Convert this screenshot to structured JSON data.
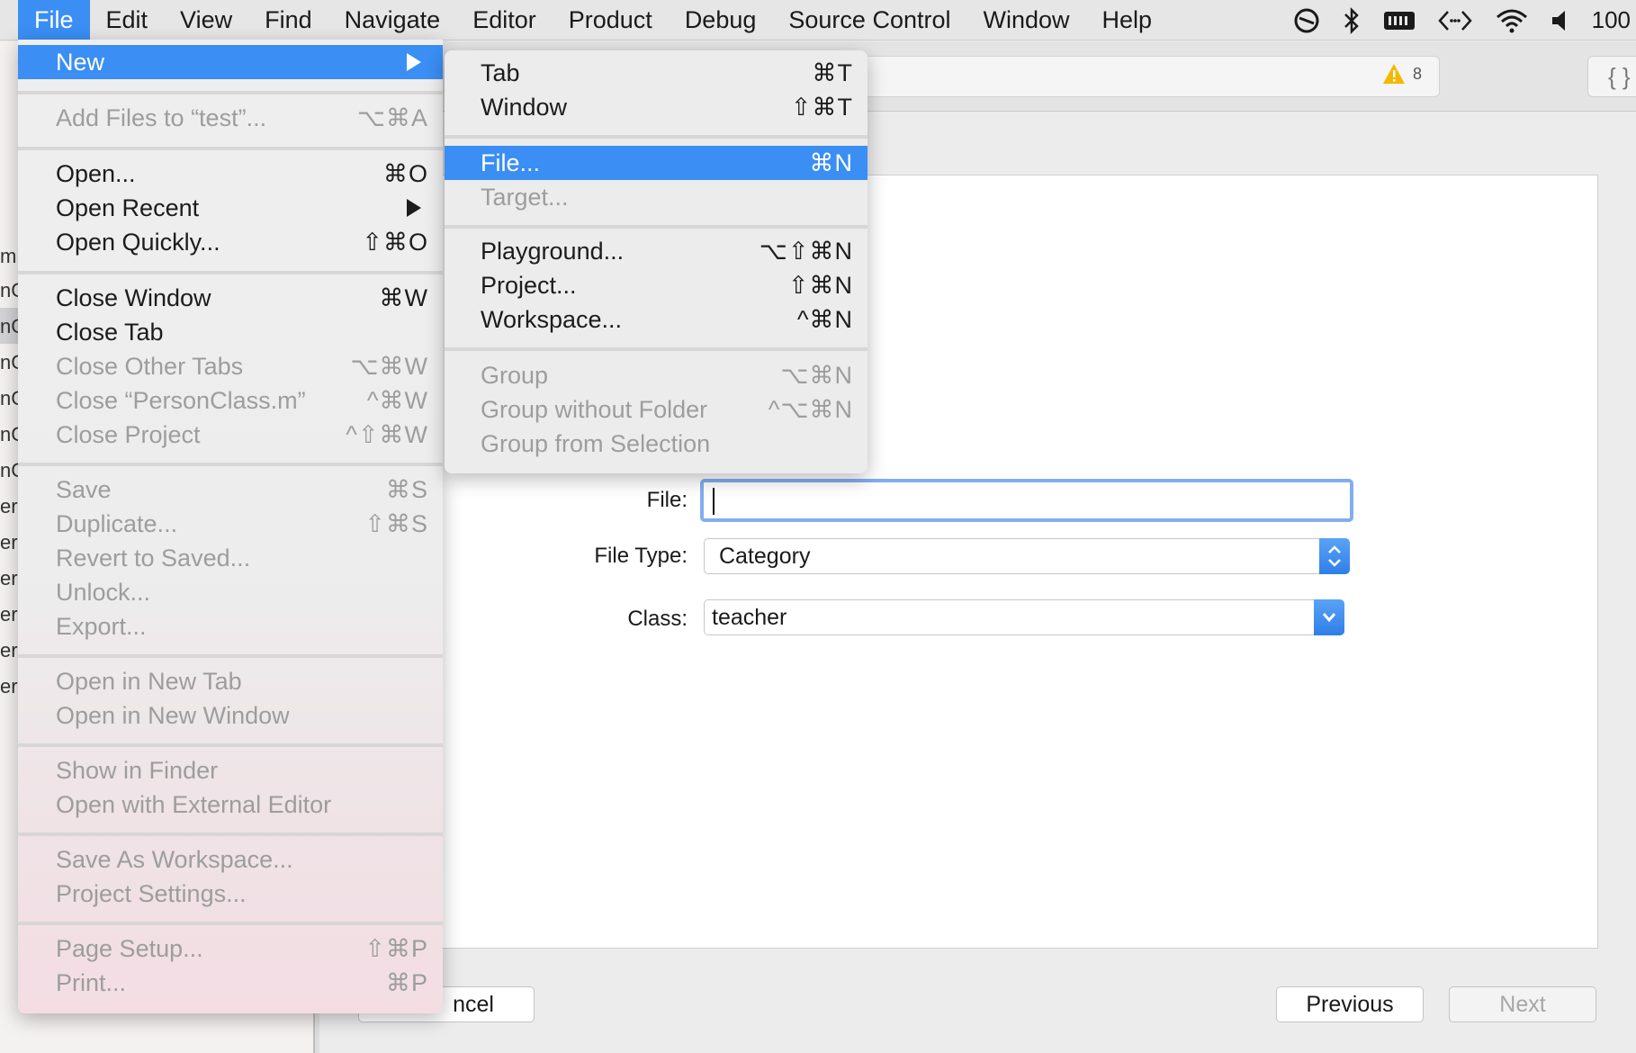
{
  "menubar": {
    "items": [
      "File",
      "Edit",
      "View",
      "Find",
      "Navigate",
      "Editor",
      "Product",
      "Debug",
      "Source Control",
      "Window",
      "Help"
    ],
    "active_index": 0,
    "battery_text": "100"
  },
  "background": {
    "sidebar_fragments": [
      "m",
      "nC",
      "nC",
      "nC",
      "nC",
      "nC",
      "nC",
      "er.",
      "er.",
      "er-",
      "er-",
      "er-",
      "er-"
    ],
    "warning_count": "8",
    "braces_label": "{ }"
  },
  "sheet": {
    "file_label": "File:",
    "file_value": "",
    "file_type_label": "File Type:",
    "file_type_value": "Category",
    "class_label": "Class:",
    "class_value": "teacher",
    "cancel_label": "ncel",
    "previous_label": "Previous",
    "next_label": "Next"
  },
  "file_menu": {
    "items": [
      {
        "label": "New",
        "shortcut": "",
        "submenu": true,
        "highlighted": true,
        "disabled": false
      },
      {
        "label": "Add Files to “test”...",
        "shortcut": "⌥⌘A",
        "disabled": true
      },
      {
        "label": "Open...",
        "shortcut": "⌘O",
        "disabled": false
      },
      {
        "label": "Open Recent",
        "shortcut": "",
        "submenu": true,
        "disabled": false
      },
      {
        "label": "Open Quickly...",
        "shortcut": "⇧⌘O",
        "disabled": false
      },
      {
        "label": "Close Window",
        "shortcut": "⌘W",
        "disabled": false
      },
      {
        "label": "Close Tab",
        "shortcut": "",
        "disabled": false
      },
      {
        "label": "Close Other Tabs",
        "shortcut": "⌥⌘W",
        "disabled": true
      },
      {
        "label": "Close “PersonClass.m”",
        "shortcut": "^⌘W",
        "disabled": true
      },
      {
        "label": "Close Project",
        "shortcut": "^⇧⌘W",
        "disabled": true
      },
      {
        "label": "Save",
        "shortcut": "⌘S",
        "disabled": true
      },
      {
        "label": "Duplicate...",
        "shortcut": "⇧⌘S",
        "disabled": true
      },
      {
        "label": "Revert to Saved...",
        "shortcut": "",
        "disabled": true
      },
      {
        "label": "Unlock...",
        "shortcut": "",
        "disabled": true
      },
      {
        "label": "Export...",
        "shortcut": "",
        "disabled": true
      },
      {
        "label": "Open in New Tab",
        "shortcut": "",
        "disabled": true
      },
      {
        "label": "Open in New Window",
        "shortcut": "",
        "disabled": true
      },
      {
        "label": "Show in Finder",
        "shortcut": "",
        "disabled": true
      },
      {
        "label": "Open with External Editor",
        "shortcut": "",
        "disabled": true
      },
      {
        "label": "Save As Workspace...",
        "shortcut": "",
        "disabled": true
      },
      {
        "label": "Project Settings...",
        "shortcut": "",
        "disabled": true
      },
      {
        "label": "Page Setup...",
        "shortcut": "⇧⌘P",
        "disabled": true
      },
      {
        "label": "Print...",
        "shortcut": "⌘P",
        "disabled": true
      }
    ]
  },
  "new_menu": {
    "items": [
      {
        "label": "Tab",
        "shortcut": "⌘T",
        "disabled": false
      },
      {
        "label": "Window",
        "shortcut": "⇧⌘T",
        "disabled": false
      },
      {
        "label": "File...",
        "shortcut": "⌘N",
        "highlighted": true,
        "disabled": false
      },
      {
        "label": "Target...",
        "shortcut": "",
        "disabled": true
      },
      {
        "label": "Playground...",
        "shortcut": "⌥⇧⌘N",
        "disabled": false
      },
      {
        "label": "Project...",
        "shortcut": "⇧⌘N",
        "disabled": false
      },
      {
        "label": "Workspace...",
        "shortcut": "^⌘N",
        "disabled": false
      },
      {
        "label": "Group",
        "shortcut": "⌥⌘N",
        "disabled": true
      },
      {
        "label": "Group without Folder",
        "shortcut": "^⌥⌘N",
        "disabled": true
      },
      {
        "label": "Group from Selection",
        "shortcut": "",
        "disabled": true
      }
    ]
  },
  "colors": {
    "highlight": "#3a8ef4",
    "disabled_text": "#9d9d9d",
    "focus_ring": "#82aef0"
  }
}
